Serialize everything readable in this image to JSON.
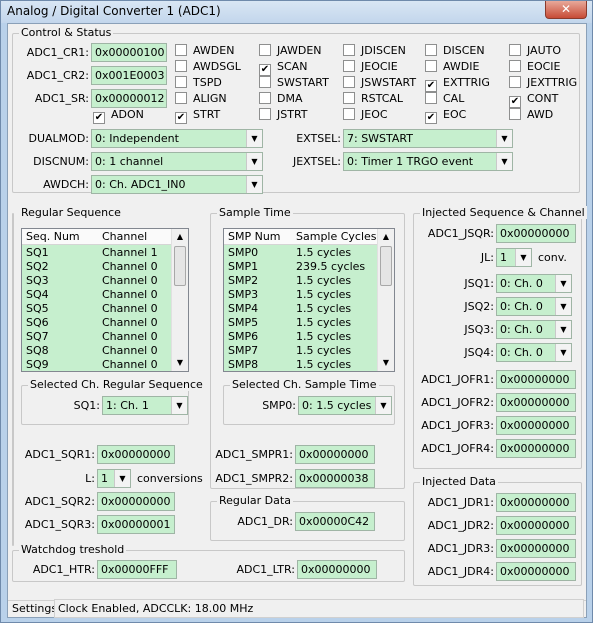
{
  "window": {
    "title": "Analog / Digital Converter 1 (ADC1)",
    "close_label": "✕"
  },
  "control": {
    "title": "Control & Status",
    "regs": [
      {
        "label": "ADC1_CR1:",
        "value": "0x00000100"
      },
      {
        "label": "ADC1_CR2:",
        "value": "0x001E0003"
      },
      {
        "label": "ADC1_SR:",
        "value": "0x00000012"
      }
    ],
    "checks": [
      {
        "label": "AWDEN",
        "checked": false
      },
      {
        "label": "JAWDEN",
        "checked": false
      },
      {
        "label": "JDISCEN",
        "checked": false
      },
      {
        "label": "DISCEN",
        "checked": false
      },
      {
        "label": "JAUTO",
        "checked": false
      },
      {
        "label": "AWDSGL",
        "checked": false
      },
      {
        "label": "SCAN",
        "checked": true
      },
      {
        "label": "JEOCIE",
        "checked": false
      },
      {
        "label": "AWDIE",
        "checked": false
      },
      {
        "label": "EOCIE",
        "checked": false
      },
      {
        "label": "TSPD",
        "checked": false
      },
      {
        "label": "SWSTART",
        "checked": false
      },
      {
        "label": "JSWSTART",
        "checked": false
      },
      {
        "label": "EXTTRIG",
        "checked": true
      },
      {
        "label": "JEXTTRIG",
        "checked": false
      },
      {
        "label": "ALIGN",
        "checked": false
      },
      {
        "label": "DMA",
        "checked": false
      },
      {
        "label": "RSTCAL",
        "checked": false
      },
      {
        "label": "CAL",
        "checked": false
      },
      {
        "label": "CONT",
        "checked": true
      },
      {
        "label": "ADON",
        "checked": true
      },
      {
        "label": "STRT",
        "checked": true
      },
      {
        "label": "JSTRT",
        "checked": false
      },
      {
        "label": "JEOC",
        "checked": false
      },
      {
        "label": "EOC",
        "checked": true
      },
      {
        "label": "AWD",
        "checked": false
      }
    ],
    "dualmod_label": "DUALMOD:",
    "dualmod": "0: Independent",
    "discnum_label": "DISCNUM:",
    "discnum": "0: 1 channel",
    "awdch_label": "AWDCH:",
    "awdch": "0:  Ch. ADC1_IN0",
    "extsel_label": "EXTSEL:",
    "extsel": "7: SWSTART",
    "jextsel_label": "JEXTSEL:",
    "jextsel": "0: Timer 1 TRGO event"
  },
  "regular": {
    "title": "Regular Sequence",
    "headers": [
      "Seq. Num",
      "Channel"
    ],
    "rows": [
      [
        "SQ1",
        "Channel 1"
      ],
      [
        "SQ2",
        "Channel 0"
      ],
      [
        "SQ3",
        "Channel 0"
      ],
      [
        "SQ4",
        "Channel 0"
      ],
      [
        "SQ5",
        "Channel 0"
      ],
      [
        "SQ6",
        "Channel 0"
      ],
      [
        "SQ7",
        "Channel 0"
      ],
      [
        "SQ8",
        "Channel 0"
      ],
      [
        "SQ9",
        "Channel 0"
      ]
    ],
    "sel_title": "Selected Ch. Regular Sequence",
    "sel_label": "SQ1:",
    "sel_value": "1: Ch. 1",
    "sqr1_label": "ADC1_SQR1:",
    "sqr1": "0x00000000",
    "l_label": "L:",
    "l_value": "1",
    "l_suffix": "conversions",
    "sqr2_label": "ADC1_SQR2:",
    "sqr2": "0x00000000",
    "sqr3_label": "ADC1_SQR3:",
    "sqr3": "0x00000001"
  },
  "sample": {
    "title": "Sample Time",
    "headers": [
      "SMP Num",
      "Sample Cycles"
    ],
    "rows": [
      [
        "SMP0",
        "1.5 cycles"
      ],
      [
        "SMP1",
        "239.5 cycles"
      ],
      [
        "SMP2",
        "1.5 cycles"
      ],
      [
        "SMP3",
        "1.5 cycles"
      ],
      [
        "SMP4",
        "1.5 cycles"
      ],
      [
        "SMP5",
        "1.5 cycles"
      ],
      [
        "SMP6",
        "1.5 cycles"
      ],
      [
        "SMP7",
        "1.5 cycles"
      ],
      [
        "SMP8",
        "1.5 cycles"
      ]
    ],
    "sel_title": "Selected Ch. Sample Time",
    "sel_label": "SMP0:",
    "sel_value": "0: 1.5 cycles",
    "smpr1_label": "ADC1_SMPR1:",
    "smpr1": "0x00000000",
    "smpr2_label": "ADC1_SMPR2:",
    "smpr2": "0x00000038"
  },
  "regdata": {
    "title": "Regular Data",
    "dr_label": "ADC1_DR:",
    "dr": "0x00000C42"
  },
  "injected": {
    "title": "Injected Sequence & Channel",
    "jsqr_label": "ADC1_JSQR:",
    "jsqr": "0x00000000",
    "jl_label": "JL:",
    "jl": "1",
    "jl_suffix": "conv.",
    "jsq": [
      {
        "label": "JSQ1:",
        "value": "0: Ch. 0"
      },
      {
        "label": "JSQ2:",
        "value": "0: Ch. 0"
      },
      {
        "label": "JSQ3:",
        "value": "0: Ch. 0"
      },
      {
        "label": "JSQ4:",
        "value": "0: Ch. 0"
      }
    ],
    "jofr": [
      {
        "label": "ADC1_JOFR1:",
        "value": "0x00000000"
      },
      {
        "label": "ADC1_JOFR2:",
        "value": "0x00000000"
      },
      {
        "label": "ADC1_JOFR3:",
        "value": "0x00000000"
      },
      {
        "label": "ADC1_JOFR4:",
        "value": "0x00000000"
      }
    ]
  },
  "injdata": {
    "title": "Injected Data",
    "jdr": [
      {
        "label": "ADC1_JDR1:",
        "value": "0x00000000"
      },
      {
        "label": "ADC1_JDR2:",
        "value": "0x00000000"
      },
      {
        "label": "ADC1_JDR3:",
        "value": "0x00000000"
      },
      {
        "label": "ADC1_JDR4:",
        "value": "0x00000000"
      }
    ]
  },
  "watchdog": {
    "title": "Watchdog treshold",
    "htr_label": "ADC1_HTR:",
    "htr": "0x00000FFF",
    "ltr_label": "ADC1_LTR:",
    "ltr": "0x00000000"
  },
  "status": {
    "label": "Settings:",
    "text": "Clock Enabled, ADCCLK: 18.00 MHz"
  }
}
